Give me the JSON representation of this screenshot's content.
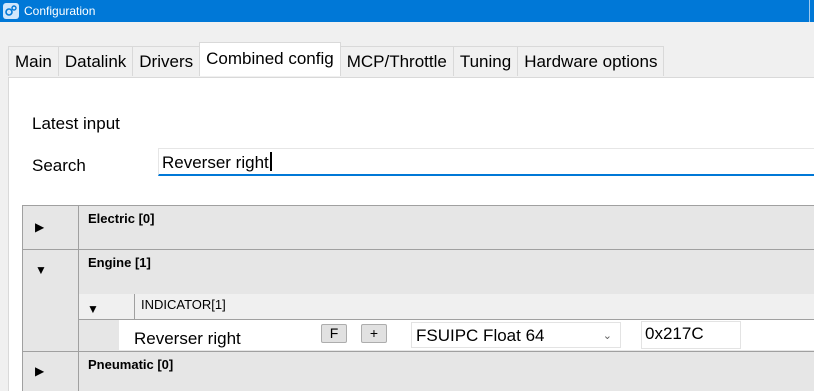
{
  "window": {
    "title": "Configuration"
  },
  "tabs": [
    {
      "label": "Main"
    },
    {
      "label": "Datalink"
    },
    {
      "label": "Drivers"
    },
    {
      "label": "Combined config",
      "active": true
    },
    {
      "label": "MCP/Throttle"
    },
    {
      "label": "Tuning"
    },
    {
      "label": "Hardware options"
    }
  ],
  "content": {
    "latest_input_label": "Latest input",
    "search_label": "Search",
    "search_value": "Reverser right"
  },
  "tree": {
    "groups": [
      {
        "name": "Electric [0]",
        "expanded": false,
        "toggle_icon": "▶"
      },
      {
        "name": "Engine [1]",
        "expanded": true,
        "toggle_icon": "▼"
      },
      {
        "name": "Pneumatic [0]",
        "expanded": false,
        "toggle_icon": "▶"
      }
    ],
    "subgroup": {
      "name": "INDICATOR[1]",
      "toggle_icon": "▼"
    },
    "item": {
      "name": "Reverser right",
      "btn_f": "F",
      "btn_plus": "+",
      "type_value": "FSUIPC Float 64",
      "address_value": "0x217C"
    }
  },
  "colors": {
    "titlebar": "#0078d7",
    "accent": "#0078d7"
  }
}
